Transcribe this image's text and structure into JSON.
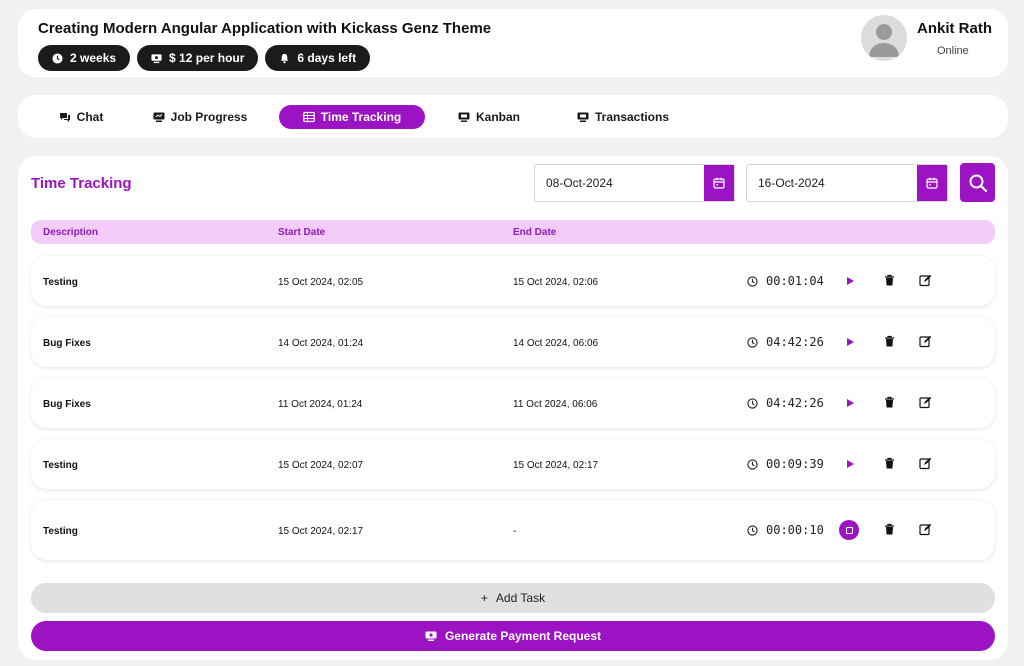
{
  "project": {
    "title": "Creating Modern Angular Application with Kickass Genz Theme",
    "chips": [
      "2 weeks",
      "$ 12  per hour",
      "6 days left"
    ]
  },
  "user": {
    "name": "Ankit Rath",
    "status": "Online"
  },
  "tabs": [
    "Chat",
    "Job Progress",
    "Time Tracking",
    "Kanban",
    "Transactions"
  ],
  "active_tab": "Time Tracking",
  "tracking": {
    "title": "Time Tracking",
    "from_date": "08-Oct-2024",
    "to_date": "16-Oct-2024",
    "columns": [
      "Description",
      "Start Date",
      "End Date"
    ],
    "rows": [
      {
        "description": "Testing",
        "start": "15 Oct 2024, 02:05",
        "end": "15 Oct 2024, 02:06",
        "duration": "00:01:04",
        "running": false
      },
      {
        "description": "Bug Fixes",
        "start": "14 Oct 2024, 01:24",
        "end": "14 Oct 2024, 06:06",
        "duration": "04:42:26",
        "running": false
      },
      {
        "description": "Bug Fixes",
        "start": "11 Oct 2024, 01:24",
        "end": "11 Oct 2024, 06:06",
        "duration": "04:42:26",
        "running": false
      },
      {
        "description": "Testing",
        "start": "15 Oct 2024, 02:07",
        "end": "15 Oct 2024, 02:17",
        "duration": "00:09:39",
        "running": false
      },
      {
        "description": "Testing",
        "start": "15 Oct 2024, 02:17",
        "end": "-",
        "duration": "00:00:10",
        "running": true
      }
    ],
    "add_task_label": "Add Task",
    "add_task_icon": "+",
    "payment_label": "Generate Payment Request"
  },
  "colors": {
    "accent": "#9c13c4",
    "header_row": "#f4ccf9"
  }
}
